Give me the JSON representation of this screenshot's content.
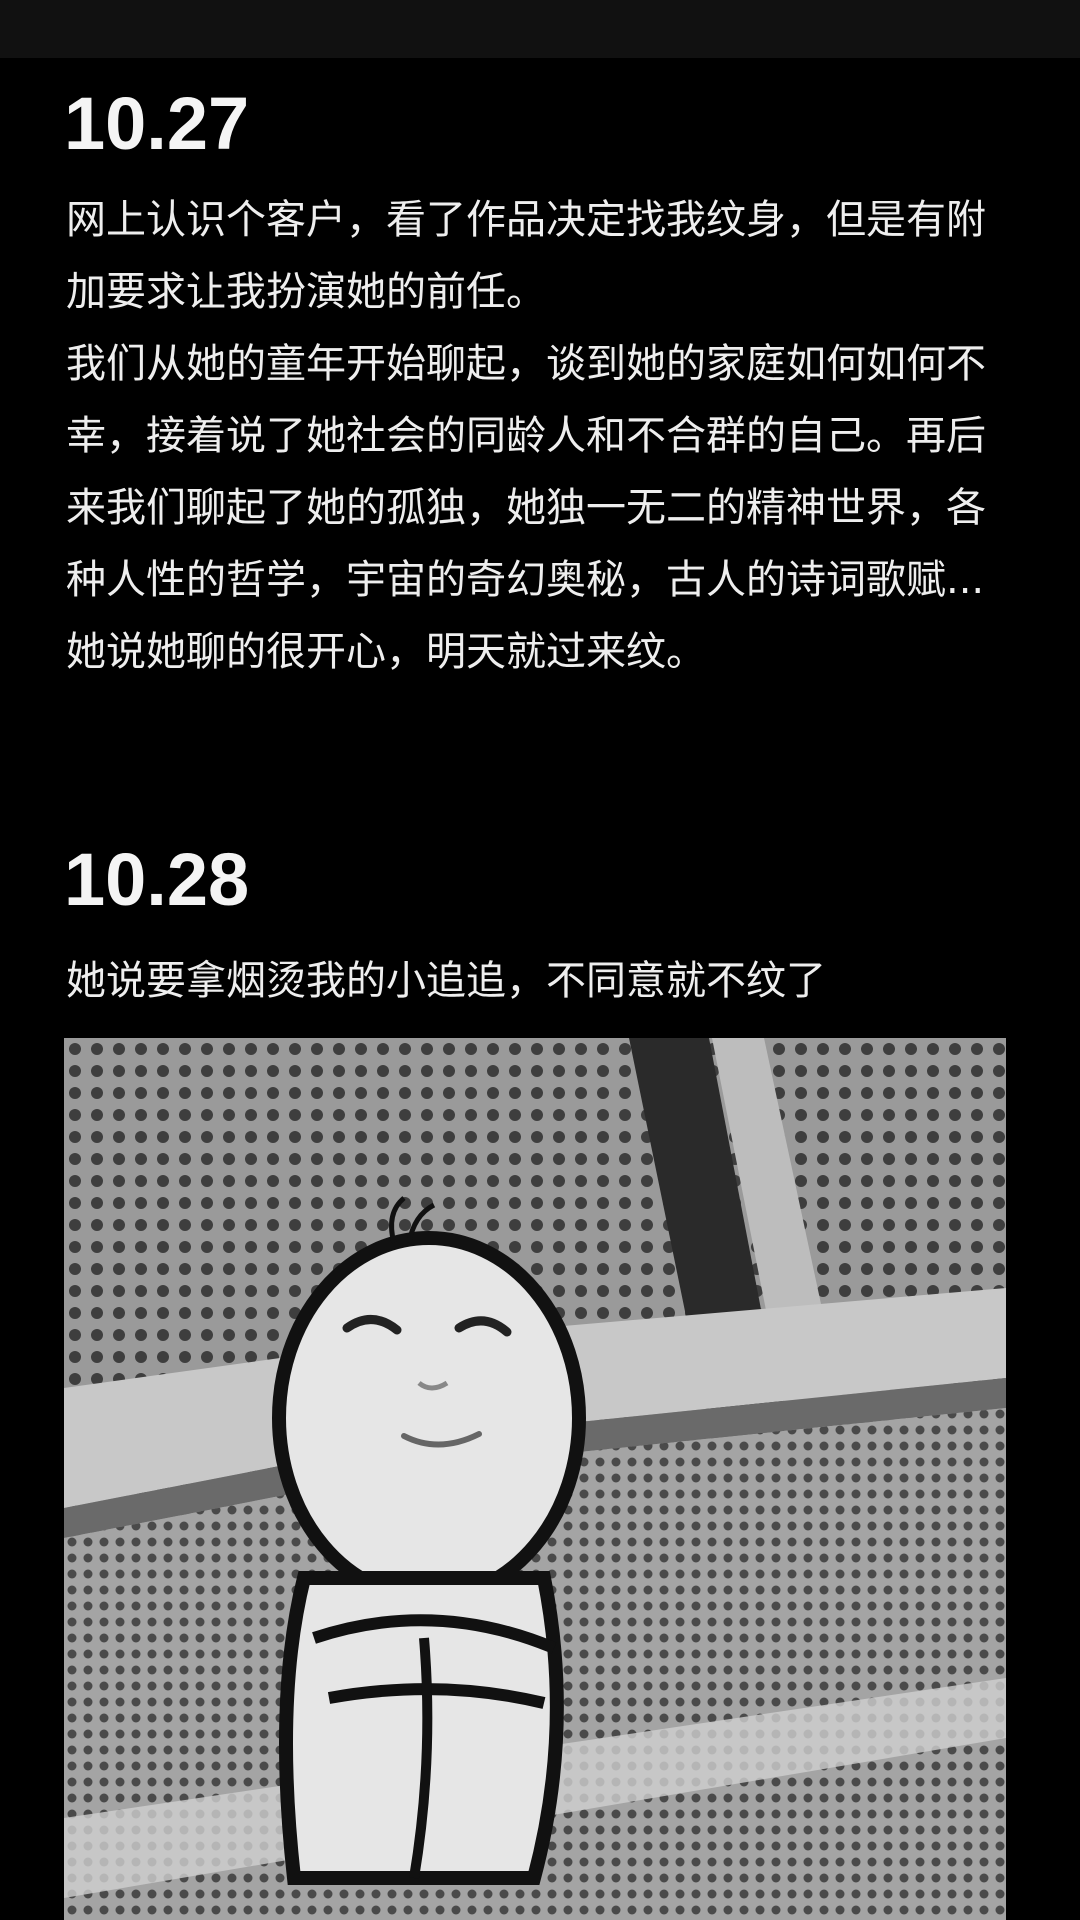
{
  "entries": [
    {
      "date": "10.27",
      "paragraphs": [
        "网上认识个客户，看了作品决定找我纹身，但是有附加要求让我扮演她的前任。",
        "我们从她的童年开始聊起，谈到她的家庭如何如何不幸，接着说了她社会的同龄人和不合群的自己。再后来我们聊起了她的孤独，她独一无二的精神世界，各种人性的哲学，宇宙的奇幻奥秘，古人的诗词歌赋...她说她聊的很开心，明天就过来纹。"
      ]
    },
    {
      "date": "10.28",
      "paragraphs": [
        "她说要拿烟烫我的小追追，不同意就不纹了"
      ]
    }
  ],
  "meme_image": {
    "icon": "sitting-cartoon-meme",
    "colors": {
      "background": "#8a8a8a",
      "figure": "#e6e6e6",
      "outline": "#111111"
    }
  }
}
